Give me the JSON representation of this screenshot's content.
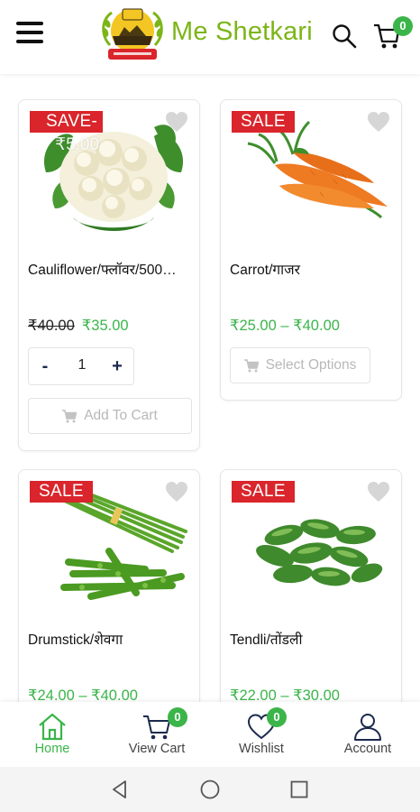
{
  "header": {
    "app_name": "Me Shetkari",
    "cart_count": "0"
  },
  "products": [
    {
      "name": "Cauliflower/फ्लॉवर/500…",
      "sale_label": "SAVE-",
      "sale_sub": "₹5.00",
      "old_price": "₹40.00",
      "price": "₹35.00",
      "quantity": "1",
      "button_label": "Add To Cart",
      "image": "cauliflower"
    },
    {
      "name": "Carrot/गाजर",
      "sale_label": "SALE",
      "price": "₹25.00 – ₹40.00",
      "button_label": "Select Options",
      "image": "carrot"
    },
    {
      "name": "Drumstick/शेवगा",
      "sale_label": "SALE",
      "price": "₹24.00 – ₹40.00",
      "image": "drumstick"
    },
    {
      "name": "Tendli/तोंडली",
      "sale_label": "SALE",
      "price": "₹22.00 – ₹30.00",
      "image": "tendli"
    }
  ],
  "bottom_nav": {
    "items": [
      {
        "label": "Home",
        "icon": "home-icon",
        "active": true
      },
      {
        "label": "View Cart",
        "icon": "cart-icon",
        "badge": "0"
      },
      {
        "label": "Wishlist",
        "icon": "heart-icon",
        "badge": "0"
      },
      {
        "label": "Account",
        "icon": "user-icon"
      }
    ]
  },
  "colors": {
    "brand_green": "#7cb518",
    "accent_green": "#3bb54a",
    "sale_red": "#d9252b",
    "nav_icon": "#1b2a4e"
  }
}
